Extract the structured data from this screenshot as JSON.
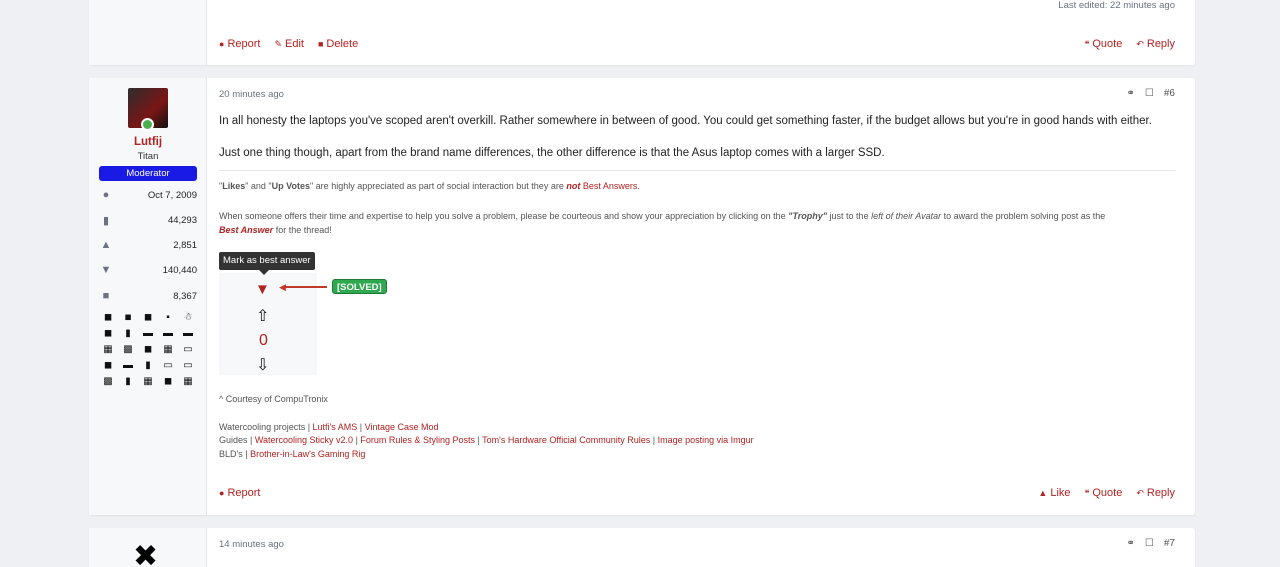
{
  "post_prev": {
    "last_edited": "Last edited: 22 minutes ago",
    "actions_left": [
      {
        "icon": "report-icon",
        "label": "Report"
      },
      {
        "icon": "edit-icon",
        "label": "Edit"
      },
      {
        "icon": "delete-icon",
        "label": "Delete"
      }
    ],
    "actions_right": [
      {
        "icon": "quote-icon",
        "label": "Quote"
      },
      {
        "icon": "reply-icon",
        "label": "Reply"
      }
    ]
  },
  "post6": {
    "user": {
      "name": "Lutfij",
      "title": "Titan",
      "badge": "Moderator",
      "stats": [
        {
          "icon": "joined-icon",
          "value": "Oct 7, 2009"
        },
        {
          "icon": "messages-icon",
          "value": "44,293"
        },
        {
          "icon": "reactions-icon",
          "value": "2,851"
        },
        {
          "icon": "points-icon",
          "value": "140,440"
        },
        {
          "icon": "posts-icon",
          "value": "8,367"
        }
      ]
    },
    "timestamp": "20 minutes ago",
    "post_number": "#6",
    "body": [
      "In all honesty the laptops you've scoped aren't overkill. Rather somewhere in between of good. You could get something faster, if the budget allows but you're in good hands with either.",
      "Just one thing though, apart from the brand name differences, the other difference is that the Asus laptop comes with a larger SSD."
    ],
    "signature": {
      "line1": {
        "q1": "\"",
        "likes": "Likes",
        "and": "\" and \"",
        "upvotes": "Up Votes",
        "mid": "\" are highly appreciated as part of social interaction but they are ",
        "not": "not",
        "best": "Best Answers",
        "end": "."
      },
      "line2": {
        "a": "When someone offers their time and expertise to help you solve a problem, please be courteous and show your appreciation by clicking on the ",
        "trophy": "\"Trophy\"",
        "b": " just to the ",
        "left": "left of their Avatar",
        "c": " to award the problem solving post as the",
        "best": "Best Answer",
        "d": " for the thread!"
      },
      "tooltip": "Mark as best answer",
      "solved": "[SOLVED]",
      "vote_count": "0",
      "courtesy": "^ Courtesy of CompuTronix",
      "projects_label": "Watercooling projects | ",
      "projects": [
        "Lutfi's AMS",
        "Vintage Case Mod"
      ],
      "guides_label": "Guides | ",
      "guides": [
        "Watercooling Sticky v2.0",
        "Forum Rules & Styling Posts",
        "Tom's Hardware Official Community Rules",
        "Image posting via Imgur"
      ],
      "blds_label": "BLD's | ",
      "blds": [
        "Brother-in-Law's Gaming Rig"
      ],
      "sep": " | "
    },
    "actions_left": [
      {
        "icon": "report-icon",
        "label": "Report"
      }
    ],
    "actions_right": [
      {
        "icon": "like-icon",
        "label": "Like"
      },
      {
        "icon": "quote-icon",
        "label": "Quote"
      },
      {
        "icon": "reply-icon",
        "label": "Reply"
      }
    ]
  },
  "post7": {
    "timestamp": "14 minutes ago",
    "post_number": "#7"
  }
}
